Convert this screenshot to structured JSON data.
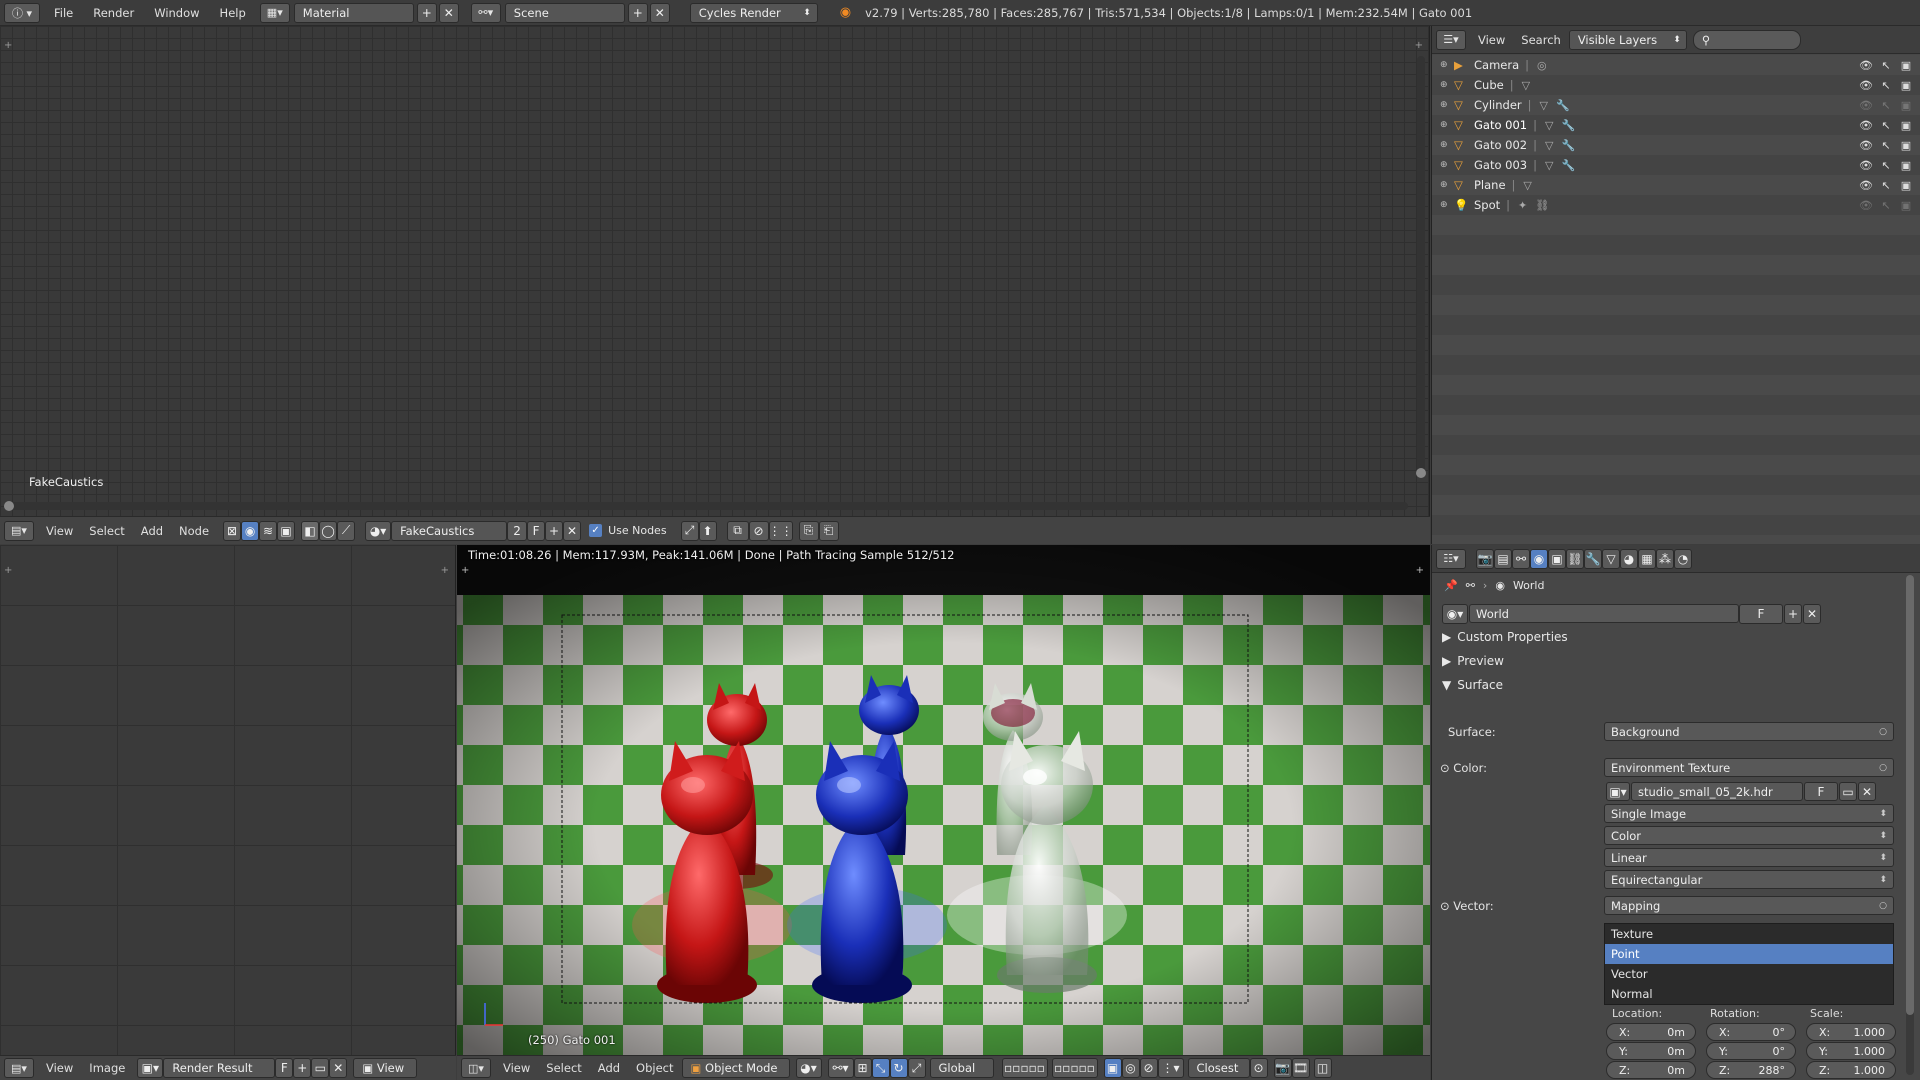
{
  "topbar": {
    "menus": [
      "File",
      "Render",
      "Window",
      "Help"
    ],
    "layout": "Material",
    "scene": "Scene",
    "engine": "Cycles Render",
    "stats": "v2.79 | Verts:285,780 | Faces:285,767 | Tris:571,534 | Objects:1/8 | Lamps:0/1 | Mem:232.54M | Gato 001"
  },
  "node_editor": {
    "label": "FakeCaustics",
    "header": {
      "menus": [
        "View",
        "Select",
        "Add",
        "Node"
      ],
      "material": "FakeCaustics",
      "users": "2",
      "fake_user": "F",
      "use_nodes": "Use Nodes"
    }
  },
  "outliner": {
    "menus": [
      "View",
      "Search"
    ],
    "display_mode": "Visible Layers",
    "items": [
      {
        "name": "Camera",
        "icon": "camera-icon"
      },
      {
        "name": "Cube",
        "icon": "mesh-icon"
      },
      {
        "name": "Cylinder",
        "icon": "mesh-icon"
      },
      {
        "name": "Gato 001",
        "icon": "mesh-icon"
      },
      {
        "name": "Gato 002",
        "icon": "mesh-icon"
      },
      {
        "name": "Gato 003",
        "icon": "mesh-icon"
      },
      {
        "name": "Plane",
        "icon": "mesh-icon"
      },
      {
        "name": "Spot",
        "icon": "lamp-icon"
      }
    ]
  },
  "image_editor": {
    "header": {
      "menus": [
        "View",
        "Image"
      ],
      "image": "Render Result",
      "fake_user": "F",
      "view": "View"
    }
  },
  "viewport": {
    "render_info": "Time:01:08.26 | Mem:117.93M, Peak:141.06M | Done | Path Tracing Sample 512/512",
    "object_label": "(250) Gato 001",
    "header": {
      "menus": [
        "View",
        "Select",
        "Add",
        "Object"
      ],
      "mode": "Object Mode",
      "orientation": "Global",
      "snap": "Closest"
    }
  },
  "properties": {
    "breadcrumb": "World",
    "world_name": "World",
    "fake_user": "F",
    "panels": {
      "custom_properties": "Custom Properties",
      "preview": "Preview",
      "surface": "Surface"
    },
    "surface_label": "Surface:",
    "surface_value": "Background",
    "color_label": "Color:",
    "color_value": "Environment Texture",
    "image_file": "studio_small_05_2k.hdr",
    "image_fake": "F",
    "source": "Single Image",
    "color_space": "Color",
    "interpolation": "Linear",
    "projection": "Equirectangular",
    "vector_label": "Vector:",
    "vector_value": "Mapping",
    "mapping_types": [
      "Texture",
      "Point",
      "Vector",
      "Normal"
    ],
    "mapping_selected": "Point",
    "location_label": "Location:",
    "rotation_label": "Rotation:",
    "scale_label": "Scale:",
    "location": {
      "x": "0m",
      "y": "0m",
      "z": "0m"
    },
    "rotation": {
      "x": "0°",
      "y": "0°",
      "z": "288°"
    },
    "scale": {
      "x": "1.000",
      "y": "1.000",
      "z": "1.000"
    },
    "axis_labels": {
      "x": "X:",
      "y": "Y:",
      "z": "Z:"
    }
  }
}
